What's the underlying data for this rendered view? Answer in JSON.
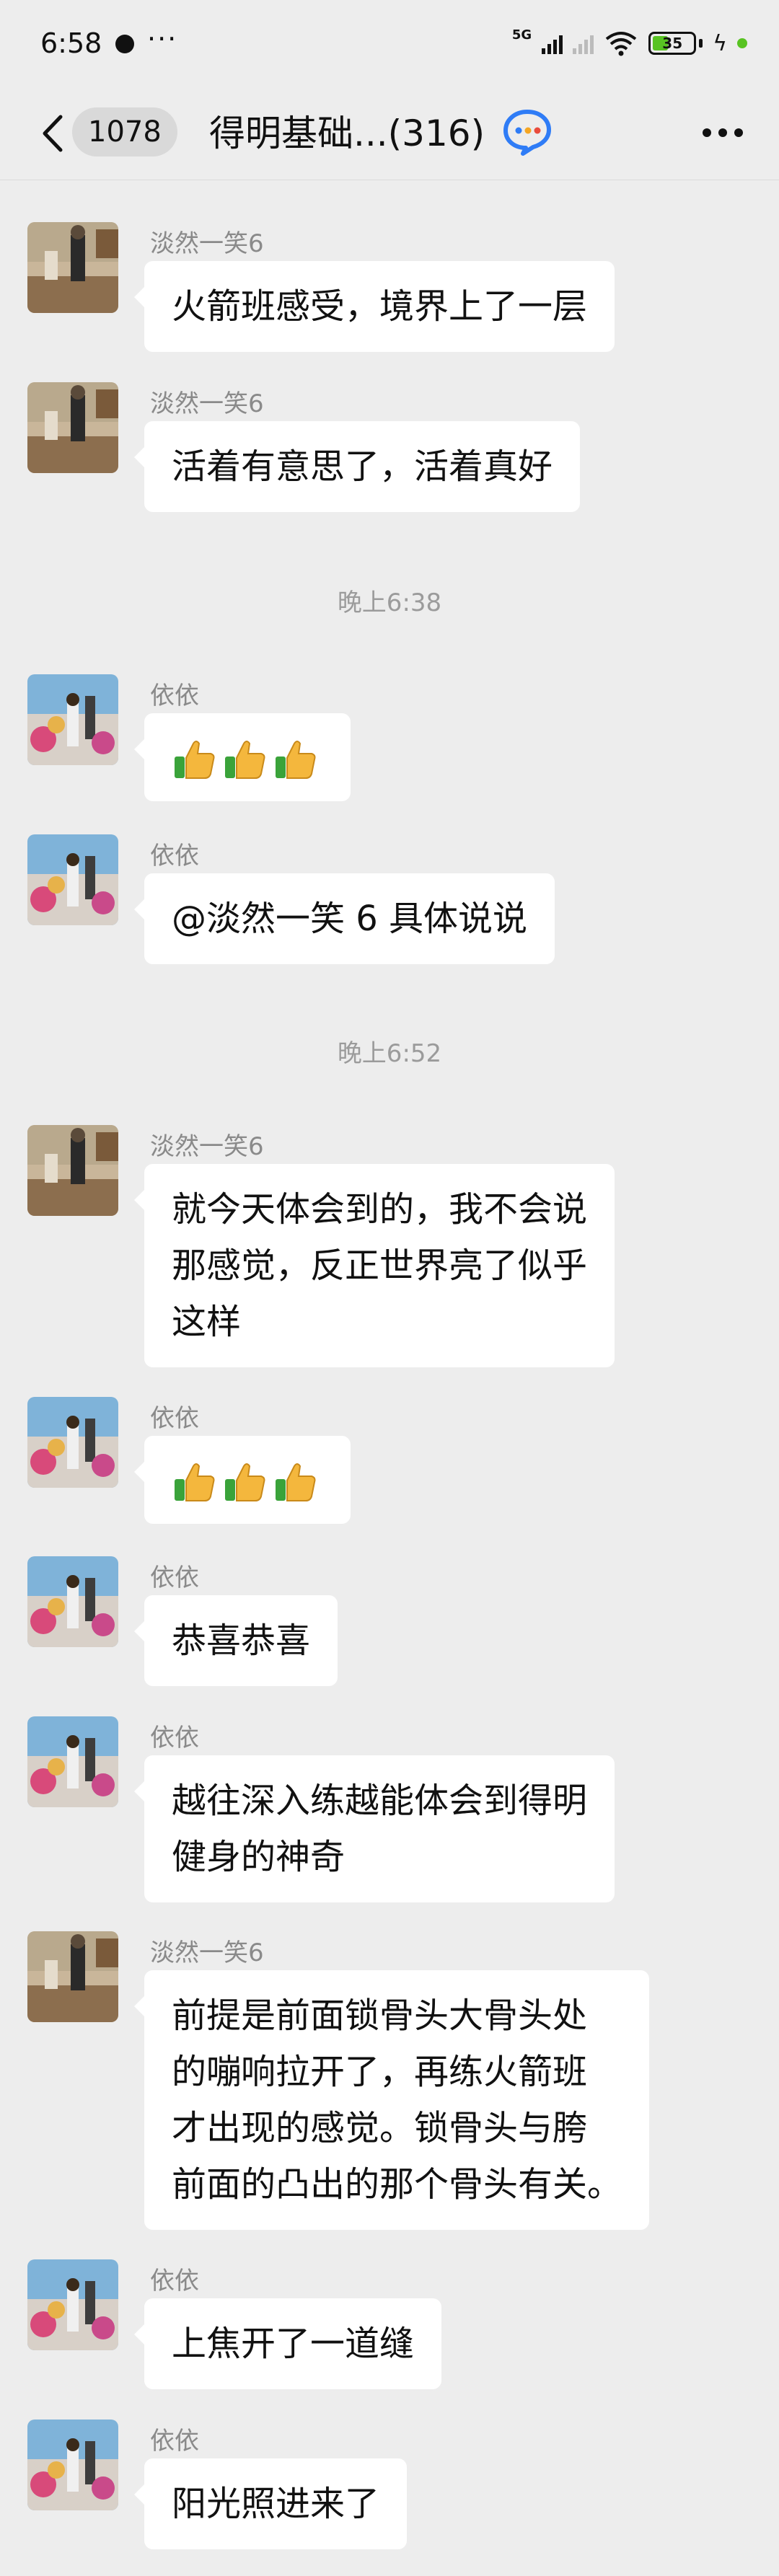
{
  "status_bar": {
    "time": "6:58",
    "more": "···",
    "network": "5G",
    "battery": "35"
  },
  "header": {
    "unread_count": "1078",
    "title": "得明基础...(316)"
  },
  "messages": [
    {
      "sender": "淡然一笑6",
      "lines": [
        "火箭班感受，境界上了一层"
      ]
    },
    {
      "sender": "淡然一笑6",
      "lines": [
        "活着有意思了，活着真好"
      ]
    },
    {
      "divider": "晚上6:38"
    },
    {
      "sender": "依依",
      "emoji": "thumbs-up x3"
    },
    {
      "sender": "依依",
      "lines": [
        "@淡然一笑 6  具体说说"
      ]
    },
    {
      "divider": "晚上6:52"
    },
    {
      "sender": "淡然一笑6",
      "lines": [
        "就今天体会到的，我不会说",
        "那感觉，反正世界亮了似乎",
        "这样"
      ]
    },
    {
      "sender": "依依",
      "emoji": "thumbs-up x3"
    },
    {
      "sender": "依依",
      "lines": [
        "恭喜恭喜"
      ]
    },
    {
      "sender": "依依",
      "lines": [
        "越往深入练越能体会到得明",
        "健身的神奇"
      ]
    },
    {
      "sender": "淡然一笑6",
      "lines": [
        "前提是前面锁骨头大骨头处",
        "的嘣响拉开了，再练火箭班",
        "才出现的感觉。锁骨头与胯",
        "前面的凸出的那个骨头有关。"
      ]
    },
    {
      "sender": "依依",
      "lines": [
        "上焦开了一道缝"
      ]
    },
    {
      "sender": "依依",
      "lines": [
        "阳光照进来了"
      ]
    }
  ],
  "colors": {
    "background": "#ededed",
    "bubble": "#ffffff",
    "sender_text": "#8a8a8a",
    "battery_green": "#58c322"
  }
}
